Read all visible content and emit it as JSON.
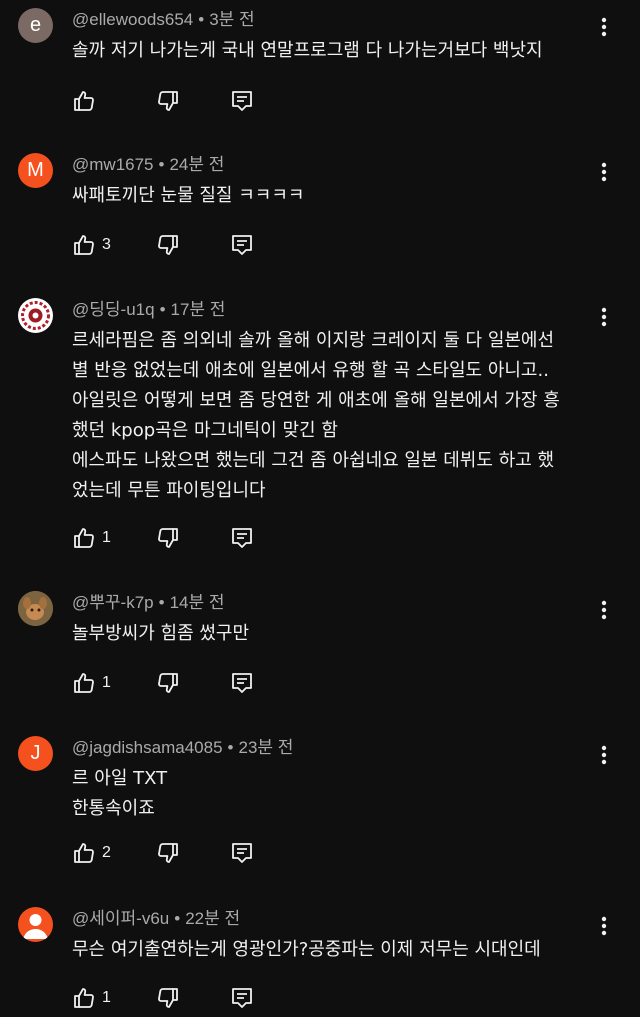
{
  "comments": [
    {
      "avatar_letter": "e",
      "avatar_color": "#7b6a63",
      "handle": "@ellewoods654",
      "time": "3분 전",
      "lines": [
        "솔까 저기 나가는게 국내 연말프로그램 다 나가는거보다 백낫지"
      ],
      "likes": ""
    },
    {
      "avatar_letter": "M",
      "avatar_color": "#f4511e",
      "handle": "@mw1675",
      "time": "24분 전",
      "lines": [
        "싸패토끼단 눈물 질질 ㅋㅋㅋㅋ"
      ],
      "likes": "3"
    },
    {
      "avatar_letter": "",
      "avatar_color": "#ffffff",
      "handle": "@딩딩-u1q",
      "time": "17분 전",
      "lines": [
        "르세라핌은 좀 의외네 솔까 올해 이지랑 크레이지 둘 다 일본에선",
        "별 반응 없었는데 애초에 일본에서 유행 할 곡 스타일도 아니고..",
        "아일릿은 어떻게 보면 좀 당연한 게 애초에 올해 일본에서 가장 흥",
        "했던 kpop곡은 마그네틱이 맞긴 함",
        "에스파도 나왔으면 했는데 그건 좀 아쉽네요 일본 데뷔도 하고 했",
        "었는데 무튼 파이팅입니다"
      ],
      "likes": "1"
    },
    {
      "avatar_letter": "",
      "avatar_color": "#8a6a3c",
      "handle": "@뿌꾸-k7p",
      "time": "14분 전",
      "lines": [
        "놀부방씨가 힘좀 썼구만"
      ],
      "likes": "1"
    },
    {
      "avatar_letter": "J",
      "avatar_color": "#f4511e",
      "handle": "@jagdishsama4085",
      "time": "23분 전",
      "lines": [
        "르 아일 TXT",
        "한통속이죠"
      ],
      "likes": "2"
    },
    {
      "avatar_letter": "",
      "avatar_color": "#f4511e",
      "handle": "@세이퍼-v6u",
      "time": "22분 전",
      "lines": [
        "무슨 여기출연하는게 영광인가?공중파는 이제 저무는 시대인데"
      ],
      "likes": "1"
    }
  ],
  "icons": {
    "like": "thumbs-up-icon",
    "dislike": "thumbs-down-icon",
    "reply": "reply-comment-icon",
    "more": "more-vertical-icon"
  }
}
